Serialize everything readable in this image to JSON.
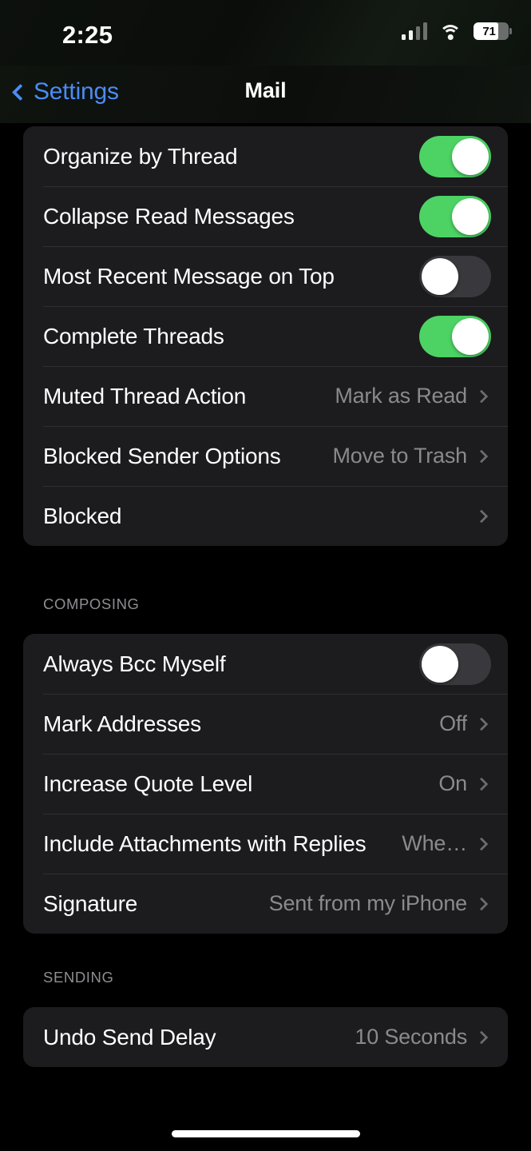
{
  "status_bar": {
    "time": "2:25",
    "battery_percent": "71",
    "battery_level": 71,
    "signal_icon": "cellular-signal-icon",
    "wifi_icon": "wifi-icon",
    "battery_icon": "battery-icon"
  },
  "nav": {
    "back_label": "Settings",
    "back_icon": "chevron-left-icon",
    "title": "Mail"
  },
  "sections": [
    {
      "header": "",
      "rows": [
        {
          "label": "Organize by Thread",
          "type": "toggle",
          "value": "on"
        },
        {
          "label": "Collapse Read Messages",
          "type": "toggle",
          "value": "on"
        },
        {
          "label": "Most Recent Message on Top",
          "type": "toggle",
          "value": "off"
        },
        {
          "label": "Complete Threads",
          "type": "toggle",
          "value": "on"
        },
        {
          "label": "Muted Thread Action",
          "type": "disclosure",
          "value": "Mark as Read"
        },
        {
          "label": "Blocked Sender Options",
          "type": "disclosure",
          "value": "Move to Trash"
        },
        {
          "label": "Blocked",
          "type": "disclosure",
          "value": ""
        }
      ]
    },
    {
      "header": "COMPOSING",
      "rows": [
        {
          "label": "Always Bcc Myself",
          "type": "toggle",
          "value": "off"
        },
        {
          "label": "Mark Addresses",
          "type": "disclosure",
          "value": "Off"
        },
        {
          "label": "Increase Quote Level",
          "type": "disclosure",
          "value": "On"
        },
        {
          "label": "Include Attachments with Replies",
          "type": "disclosure",
          "value": "Whe…",
          "truncated": true
        },
        {
          "label": "Signature",
          "type": "disclosure",
          "value": "Sent from my iPhone"
        }
      ]
    },
    {
      "header": "SENDING",
      "rows": [
        {
          "label": "Undo Send Delay",
          "type": "disclosure",
          "value": "10 Seconds"
        }
      ]
    }
  ],
  "colors": {
    "accent_blue": "#4a8cf5",
    "toggle_on_green": "#4cd364",
    "toggle_off_gray": "#39393d",
    "card_background": "#1c1c1e",
    "page_background": "#000000",
    "secondary_text": "#8a8a8e",
    "header_text": "#8e8e93"
  },
  "home_indicator": "home-indicator"
}
